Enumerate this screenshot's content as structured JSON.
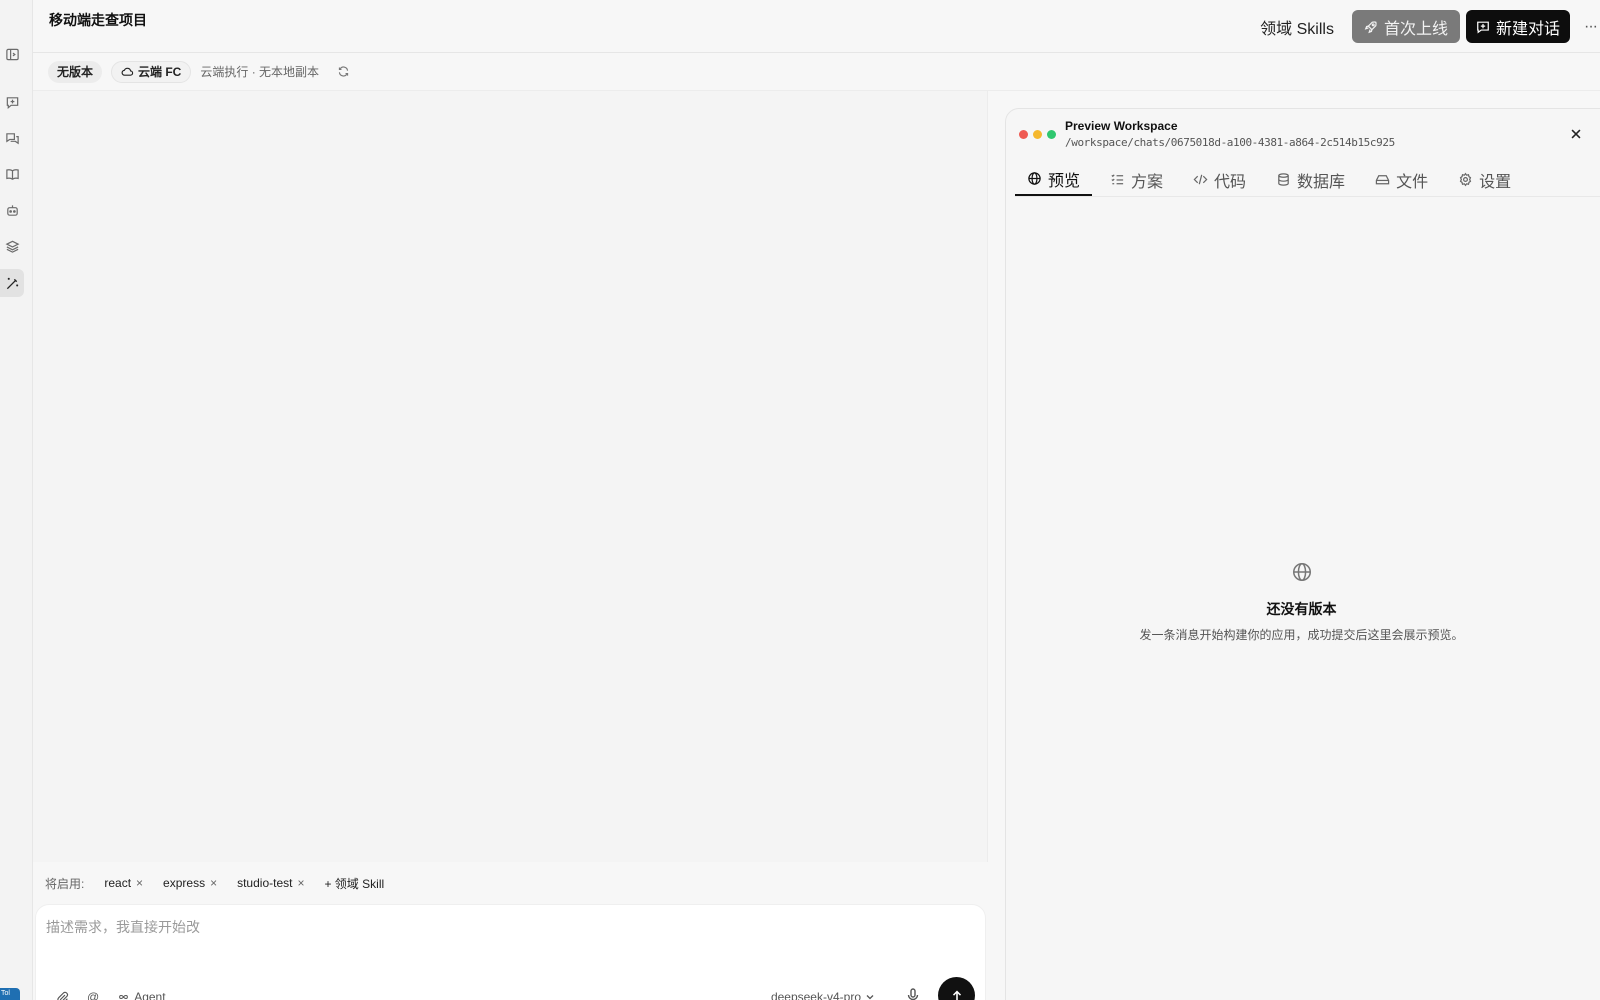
{
  "rail": {
    "items": [
      "panel-toggle",
      "new-chat",
      "conversations",
      "knowledge-book",
      "agent-bot",
      "layers",
      "magic-wand"
    ],
    "corner_badge": "Tol"
  },
  "header": {
    "project_title": "移动端走查项目",
    "skills_link": "领域 Skills",
    "launch_button": "首次上线",
    "new_chat_button": "新建对话",
    "more": "···"
  },
  "subbar": {
    "version_pill": "无版本",
    "cloud_pill": "云端 FC",
    "note": "云端执行 · 无本地副本"
  },
  "skills": {
    "label": "将启用:",
    "chips": [
      "react",
      "express",
      "studio-test"
    ],
    "remove_glyph": "×",
    "add_label": "+ 领域 Skill"
  },
  "composer": {
    "placeholder": "描述需求，我直接开始改",
    "agent_label": "Agent",
    "at_symbol": "@",
    "model": "deepseek-v4-pro"
  },
  "preview": {
    "title": "Preview Workspace",
    "path": "/workspace/chats/0675018d-a100-4381-a864-2c514b15c925",
    "tabs": [
      {
        "label": "预览",
        "icon": "globe-icon"
      },
      {
        "label": "方案",
        "icon": "checklist-icon"
      },
      {
        "label": "代码",
        "icon": "code-icon"
      },
      {
        "label": "数据库",
        "icon": "database-icon"
      },
      {
        "label": "文件",
        "icon": "drive-icon"
      },
      {
        "label": "设置",
        "icon": "gear-icon"
      }
    ],
    "empty_title": "还没有版本",
    "empty_desc": "发一条消息开始构建你的应用，成功提交后这里会展示预览。"
  },
  "colors": {
    "traffic_red": "#ef5a52",
    "traffic_yellow": "#f5b82e",
    "traffic_green": "#2fc76f",
    "launch_bg": "#7a7a7a",
    "primary_bg": "#0d0d0d"
  }
}
